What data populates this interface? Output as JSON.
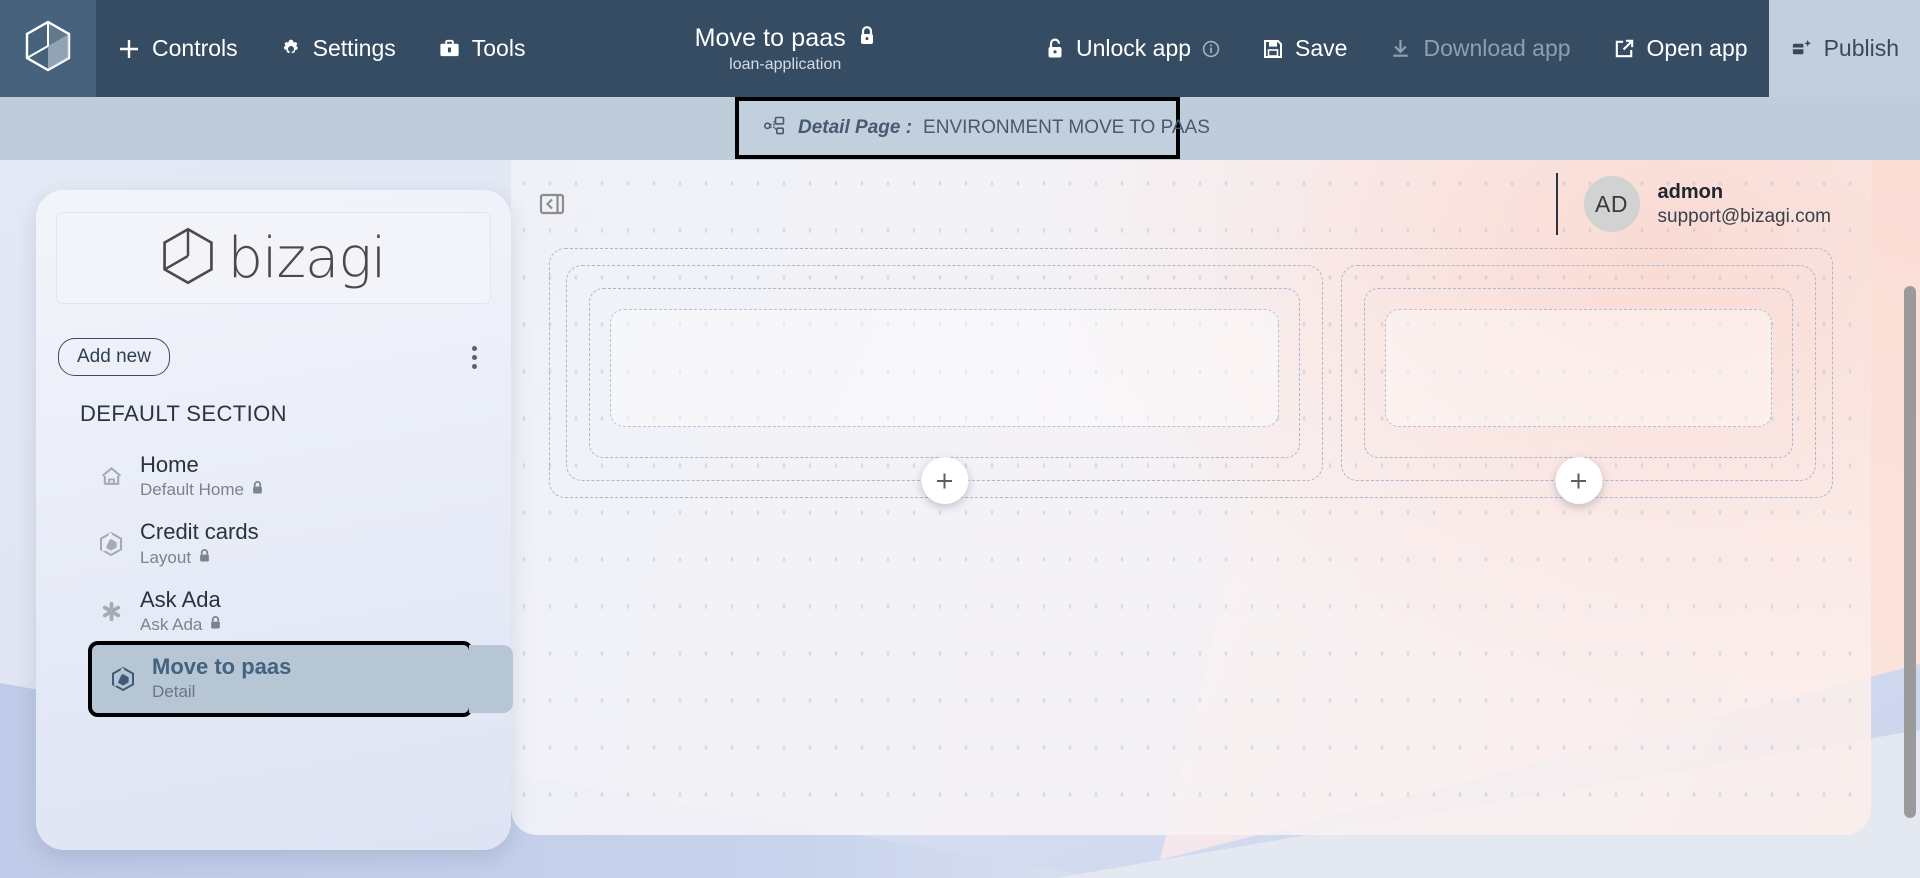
{
  "toolbar": {
    "logo_icon": "bizagi-hex-logo-icon",
    "items_left": [
      {
        "label": "Controls",
        "icon": "plus-icon"
      },
      {
        "label": "Settings",
        "icon": "gear-icon"
      },
      {
        "label": "Tools",
        "icon": "toolbox-icon"
      }
    ],
    "app_title": "Move to paas",
    "app_title_lock_icon": "lock-closed-icon",
    "app_subtitle": "loan-application",
    "items_right": [
      {
        "label": "Unlock app",
        "icon": "lock-open-icon",
        "info_icon": "info-circle-icon",
        "disabled": false
      },
      {
        "label": "Save",
        "icon": "floppy-disk-icon",
        "disabled": false
      },
      {
        "label": "Download app",
        "icon": "download-icon",
        "disabled": true
      },
      {
        "label": "Open app",
        "icon": "external-link-icon",
        "disabled": false
      },
      {
        "label": "Publish",
        "icon": "publish-icon",
        "disabled": false
      }
    ]
  },
  "breadcrumb": {
    "icon": "detail-page-icon",
    "label": "Detail Page :",
    "value": "ENVIRONMENT MOVE TO PAAS"
  },
  "sidebar": {
    "brand_text": "bizagi",
    "brand_icon": "bizagi-hex-logo-icon",
    "add_new_label": "Add new",
    "kebab_icon": "kebab-menu-icon",
    "section_title": "DEFAULT SECTION",
    "items": [
      {
        "title": "Home",
        "subtitle": "Default Home",
        "icon": "home-icon",
        "locked": true,
        "selected": false
      },
      {
        "title": "Credit cards",
        "subtitle": "Layout",
        "icon": "hex-icon",
        "locked": true,
        "selected": false
      },
      {
        "title": "Ask Ada",
        "subtitle": "Ask Ada",
        "icon": "asterisk-icon",
        "locked": true,
        "selected": false
      },
      {
        "title": "Move to paas",
        "subtitle": "Detail",
        "icon": "hex-icon",
        "locked": false,
        "selected": true
      }
    ]
  },
  "canvas": {
    "collapse_icon": "collapse-sidebar-icon",
    "user": {
      "initials": "AD",
      "name": "admon",
      "email": "support@bizagi.com"
    },
    "add_widget_icon": "plus-icon",
    "zones": [
      {
        "name": "left-drop-zone",
        "add_label": "+"
      },
      {
        "name": "right-drop-zone",
        "add_label": "+"
      }
    ]
  },
  "colors": {
    "toolbar_bg": "#364c63",
    "logo_tile_bg": "#47627d",
    "breadcrumb_bg": "#bfcddb",
    "publish_bg": "#c2d0de",
    "selected_item_bg": "#b6c6d4",
    "selected_item_text": "#45627f",
    "dashed_border": "#a9b7d4",
    "scrollbar_thumb": "#9a9a9a"
  }
}
